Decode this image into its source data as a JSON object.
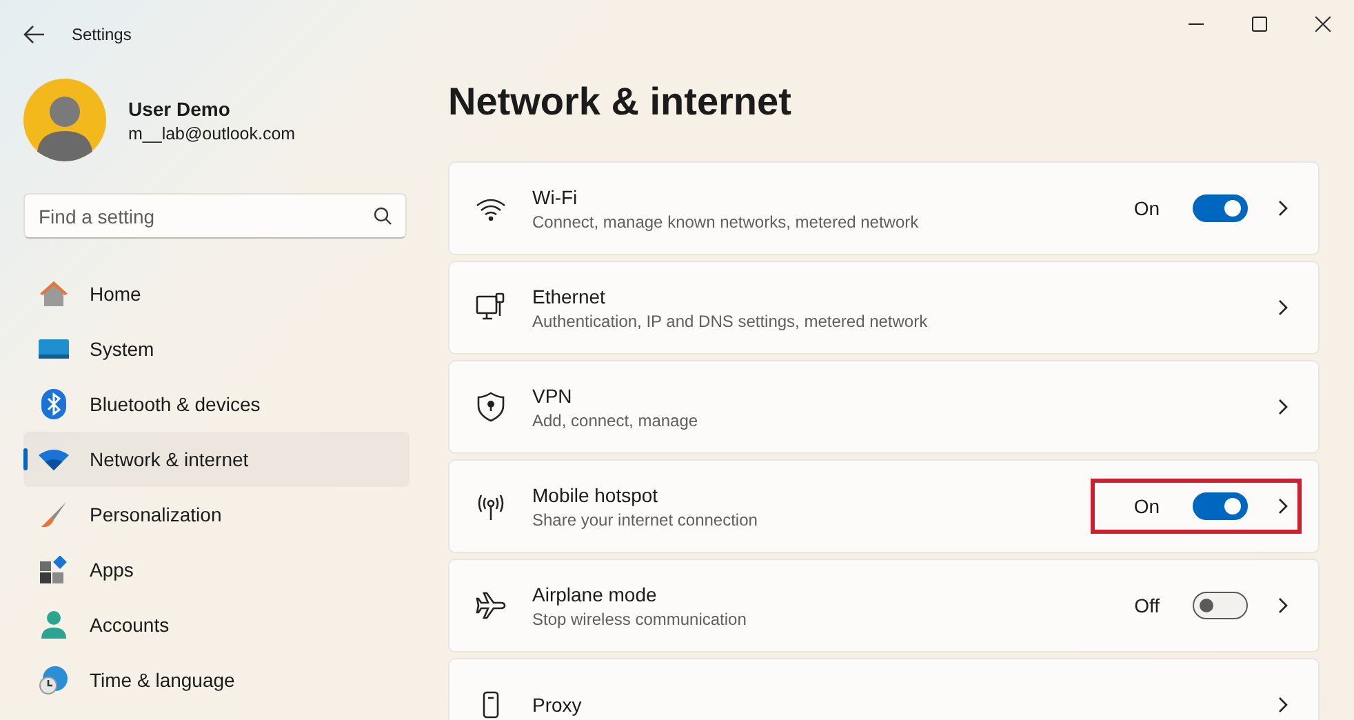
{
  "window": {
    "title": "Settings"
  },
  "profile": {
    "name": "User Demo",
    "email": "m__lab@outlook.com"
  },
  "search": {
    "placeholder": "Find a setting"
  },
  "sidebar": {
    "items": [
      {
        "label": "Home",
        "selected": false
      },
      {
        "label": "System",
        "selected": false
      },
      {
        "label": "Bluetooth & devices",
        "selected": false
      },
      {
        "label": "Network & internet",
        "selected": true
      },
      {
        "label": "Personalization",
        "selected": false
      },
      {
        "label": "Apps",
        "selected": false
      },
      {
        "label": "Accounts",
        "selected": false
      },
      {
        "label": "Time & language",
        "selected": false
      }
    ]
  },
  "page": {
    "title": "Network & internet"
  },
  "cards": [
    {
      "title": "Wi-Fi",
      "subtitle": "Connect, manage known networks, metered network",
      "kind": "toggle",
      "on": true,
      "state_label": "On",
      "highlighted": false
    },
    {
      "title": "Ethernet",
      "subtitle": "Authentication, IP and DNS settings, metered network",
      "kind": "link",
      "highlighted": false
    },
    {
      "title": "VPN",
      "subtitle": "Add, connect, manage",
      "kind": "link",
      "highlighted": false
    },
    {
      "title": "Mobile hotspot",
      "subtitle": "Share your internet connection",
      "kind": "toggle",
      "on": true,
      "state_label": "On",
      "highlighted": true
    },
    {
      "title": "Airplane mode",
      "subtitle": "Stop wireless communication",
      "kind": "toggle",
      "on": false,
      "state_label": "Off",
      "highlighted": false
    },
    {
      "title": "Proxy",
      "kind": "link",
      "highlighted": false
    }
  ]
}
